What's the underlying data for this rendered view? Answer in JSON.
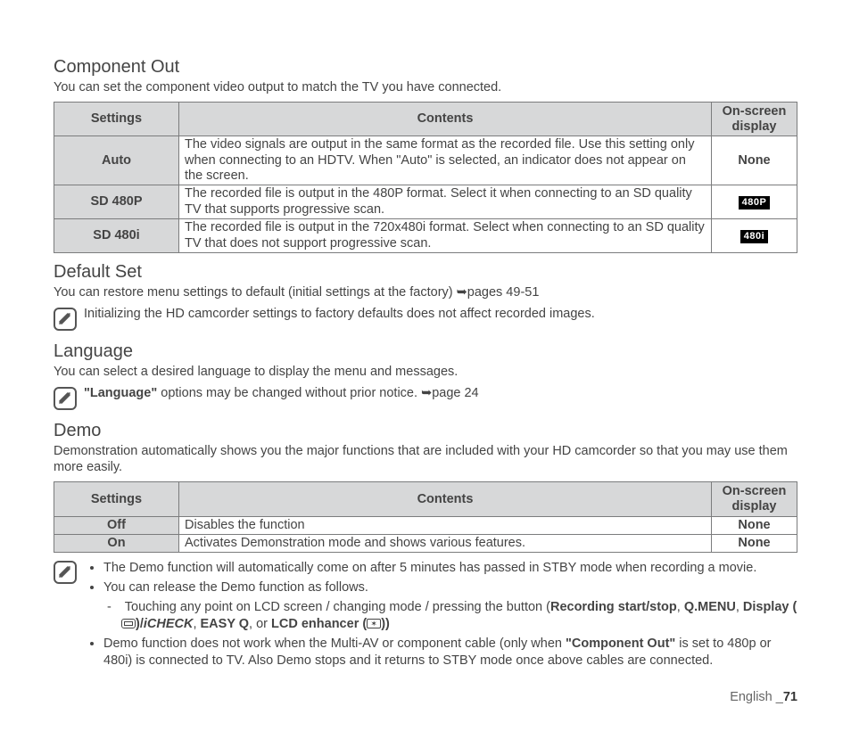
{
  "componentOut": {
    "heading": "Component Out",
    "intro": "You can set the component video output to match the TV you have connected.",
    "headers": {
      "settings": "Settings",
      "contents": "Contents",
      "osd": "On-screen display"
    },
    "rows": [
      {
        "setting": "Auto",
        "content": "The video signals are output in the same format as the recorded file. Use this setting only when connecting to an HDTV. When \"Auto\" is selected, an indicator does not appear on the screen.",
        "osd_text": "None",
        "osd_badge": ""
      },
      {
        "setting": "SD 480P",
        "content": "The recorded file is output in the 480P format. Select it when connecting to an SD quality TV that supports progressive scan.",
        "osd_text": "",
        "osd_badge": "480P"
      },
      {
        "setting": "SD 480i",
        "content": "The recorded file is output in the 720x480i format. Select when connecting to an SD quality TV that does not support progressive scan.",
        "osd_text": "",
        "osd_badge": "480i"
      }
    ]
  },
  "defaultSet": {
    "heading": "Default Set",
    "intro_pre": "You can restore menu settings to default (initial settings at the factory) ",
    "intro_ref": "➥pages 49-51",
    "note": "Initializing the HD camcorder settings to factory defaults does not affect recorded images."
  },
  "language": {
    "heading": "Language",
    "intro": "You can select a desired language to display the menu and messages.",
    "note_bold": "\"Language\"",
    "note_rest": " options may be changed without prior notice. ",
    "note_ref": "➥page 24"
  },
  "demo": {
    "heading": "Demo",
    "intro": "Demonstration automatically shows you the major functions that are included with your HD camcorder so that you may use them more easily.",
    "headers": {
      "settings": "Settings",
      "contents": "Contents",
      "osd": "On-screen display"
    },
    "rows": [
      {
        "setting": "Off",
        "content": "Disables the function",
        "osd_text": "None"
      },
      {
        "setting": "On",
        "content": "Activates Demonstration mode and shows various features.",
        "osd_text": "None"
      }
    ],
    "notes": {
      "b1": "The Demo function will automatically come on after 5 minutes has passed in STBY mode when recording a movie.",
      "b2": "You can release the Demo function as follows.",
      "b2a_pre": "Touching any point on LCD screen / changing mode / pressing the button (",
      "b2a_rec": "Recording start/stop",
      "b2a_qmenu": "Q.MENU",
      "b2b_display_pre": "Display (",
      "b2b_display_post": ")/",
      "b2b_icheck": "iCHECK",
      "b2b_easyq": "EASY Q",
      "b2b_or": ", or ",
      "b2b_lcd_pre": "LCD enhancer (",
      "b2b_lcd_post": "))",
      "b3_pre": "Demo function does not work when the Multi-AV or component cable (only when ",
      "b3_bold": "\"Component Out\"",
      "b3_post": " is set to 480p or 480i) is connected to TV. Also Demo stops and it returns to STBY mode once above cables are connected."
    }
  },
  "footer": {
    "lang": "English ",
    "sep": "_",
    "page": "71"
  }
}
